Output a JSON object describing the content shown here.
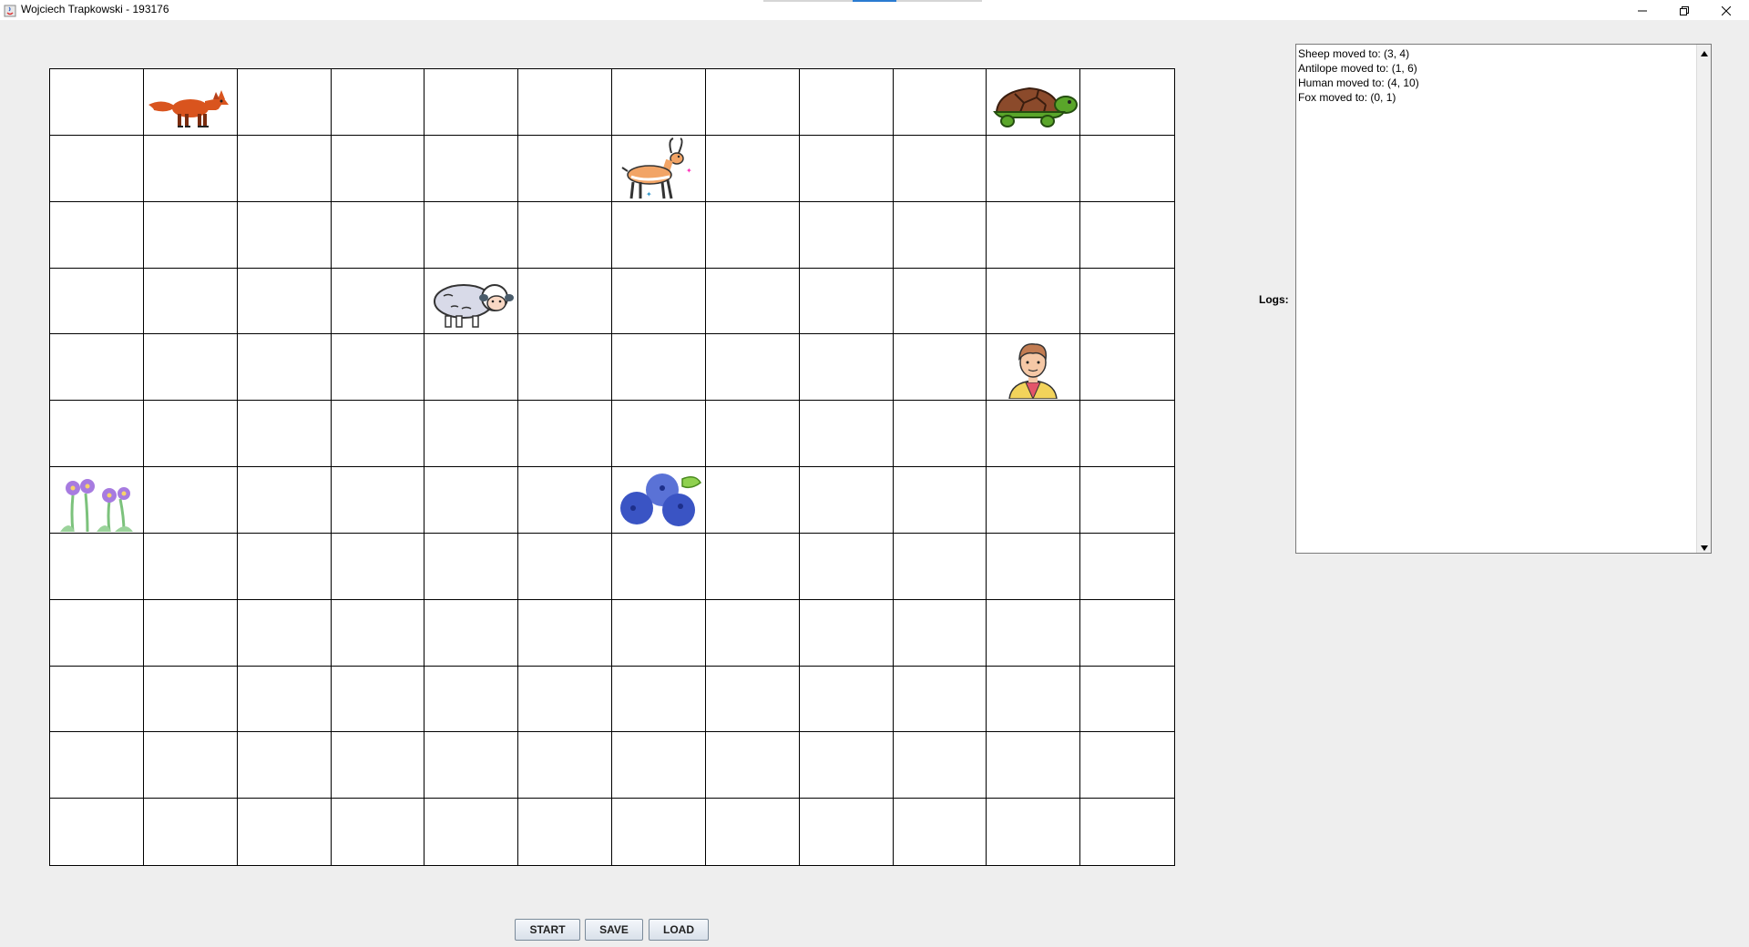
{
  "window": {
    "title": "Wojciech Trapkowski - 193176",
    "controls": [
      "minimize-icon",
      "maximize-icon",
      "close-icon"
    ]
  },
  "board": {
    "rows": 12,
    "cols": 12,
    "organisms": [
      {
        "name": "fox",
        "row": 0,
        "col": 1
      },
      {
        "name": "turtle",
        "row": 0,
        "col": 10
      },
      {
        "name": "antelope",
        "row": 1,
        "col": 6
      },
      {
        "name": "sheep",
        "row": 3,
        "col": 4
      },
      {
        "name": "human",
        "row": 4,
        "col": 10
      },
      {
        "name": "flowers",
        "row": 6,
        "col": 0
      },
      {
        "name": "blueberries",
        "row": 6,
        "col": 6
      }
    ]
  },
  "logs": {
    "label": "Logs:",
    "lines": [
      "Sheep moved to: (3, 4)",
      "Antilope moved to: (1, 6)",
      "Human moved to: (4, 10)",
      "Fox moved to: (0, 1)"
    ]
  },
  "buttons": {
    "start": "START",
    "save": "SAVE",
    "load": "LOAD"
  }
}
